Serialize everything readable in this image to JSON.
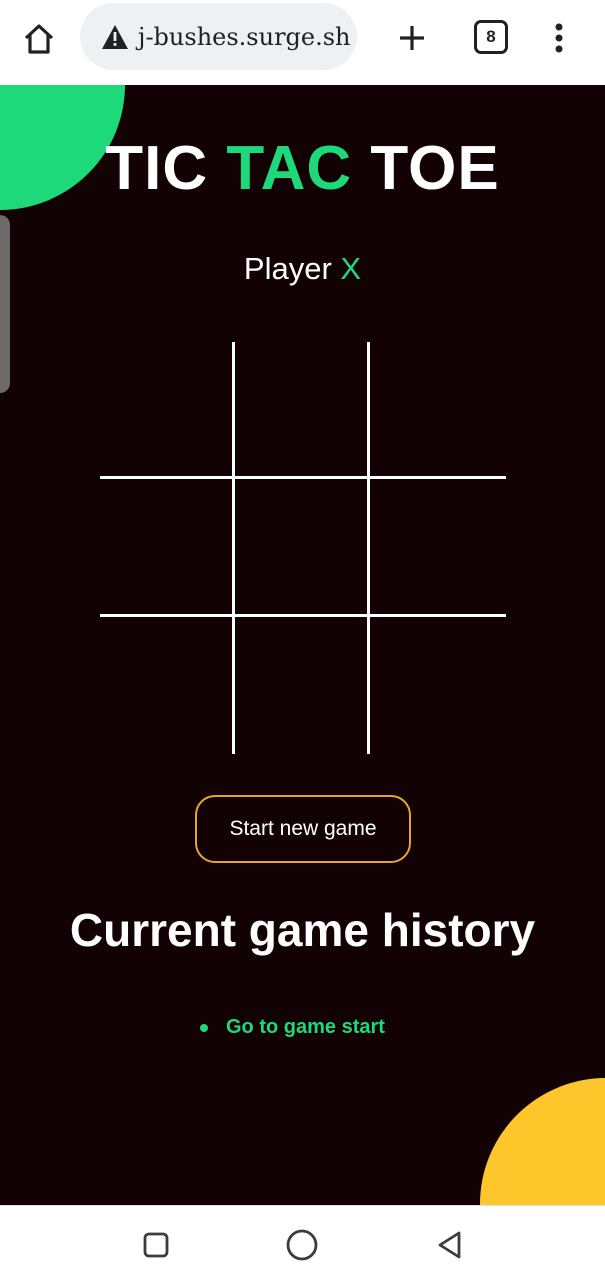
{
  "browser": {
    "url": "j-bushes.surge.sh",
    "tab_count": "8",
    "icons": {
      "home": "home-icon",
      "security": "warning-icon",
      "new_tab": "plus-icon",
      "tabs": "tabs-icon",
      "menu": "more-vert-icon"
    }
  },
  "game": {
    "title_part1": "TIC",
    "title_part2": "TAC",
    "title_part3": "TOE",
    "player_label": "Player",
    "player_mark": "X",
    "board_cells": [
      "",
      "",
      "",
      "",
      "",
      "",
      "",
      "",
      ""
    ],
    "new_game_label": "Start new game",
    "history_title": "Current game history",
    "history_moves": [
      {
        "label": "Go to game start"
      }
    ]
  },
  "colors": {
    "background": "#130203",
    "accent_green": "#1ed97a",
    "accent_yellow": "#fdc62b",
    "button_border": "#e6a62c",
    "text": "#ffffff"
  },
  "system_nav": {
    "icons": [
      "recents-square-icon",
      "home-circle-icon",
      "back-triangle-icon"
    ]
  }
}
